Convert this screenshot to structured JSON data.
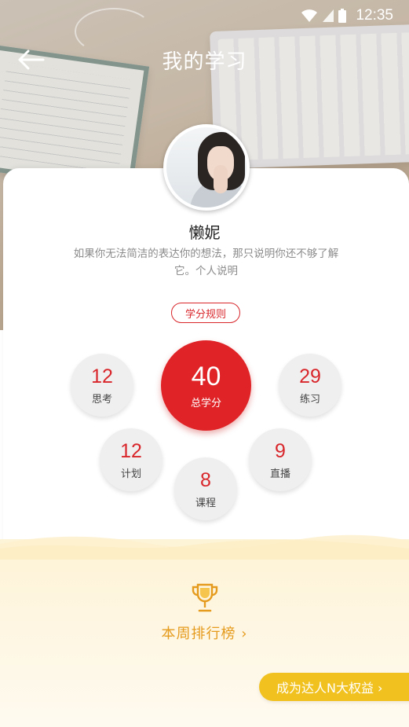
{
  "status_bar": {
    "time": "12:35"
  },
  "nav": {
    "title": "我的学习"
  },
  "profile": {
    "name": "懒妮",
    "motto": "如果你无法简洁的表达你的想法，那只说明你还不够了解它。个人说明"
  },
  "rule_button": "学分规则",
  "stats": {
    "total": {
      "value": "40",
      "label": "总学分"
    },
    "thinking": {
      "value": "12",
      "label": "思考"
    },
    "practice": {
      "value": "29",
      "label": "练习"
    },
    "plan": {
      "value": "12",
      "label": "计划"
    },
    "live": {
      "value": "9",
      "label": "直播"
    },
    "course": {
      "value": "8",
      "label": "课程"
    }
  },
  "ranking": {
    "label": "本周排行榜 ›"
  },
  "vip": {
    "label": "成为达人N大权益 ›"
  },
  "colors": {
    "accent": "#df2326",
    "gold": "#e59b1d",
    "pill": "#f1c21f"
  }
}
